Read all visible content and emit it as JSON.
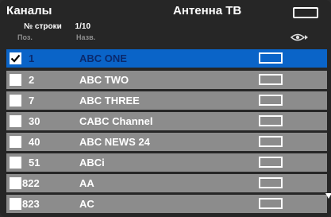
{
  "header": {
    "title": "Каналы",
    "source": "Антенна ТВ",
    "row_label": "№ строки",
    "row_value": "1/10",
    "col_position": "Поз.",
    "col_name": "Назв."
  },
  "icons": {
    "screen": "screen-icon",
    "eye": "eye-icon",
    "scroll": "scroll-down-icon"
  },
  "colors": {
    "selected": "#0a64c8",
    "row": "#8c8c8c",
    "background": "#262626"
  },
  "channels": [
    {
      "num": "1",
      "name": "ABC ONE",
      "selected": true,
      "checked": true
    },
    {
      "num": "2",
      "name": "ABC TWO",
      "selected": false,
      "checked": false
    },
    {
      "num": "7",
      "name": "ABC THREE",
      "selected": false,
      "checked": false
    },
    {
      "num": "30",
      "name": "CABC Channel",
      "selected": false,
      "checked": false
    },
    {
      "num": "40",
      "name": "ABC NEWS 24",
      "selected": false,
      "checked": false
    },
    {
      "num": "51",
      "name": "ABCi",
      "selected": false,
      "checked": false
    },
    {
      "num": "822",
      "name": "AA",
      "selected": false,
      "checked": false
    },
    {
      "num": "823",
      "name": "AC",
      "selected": false,
      "checked": false
    }
  ]
}
